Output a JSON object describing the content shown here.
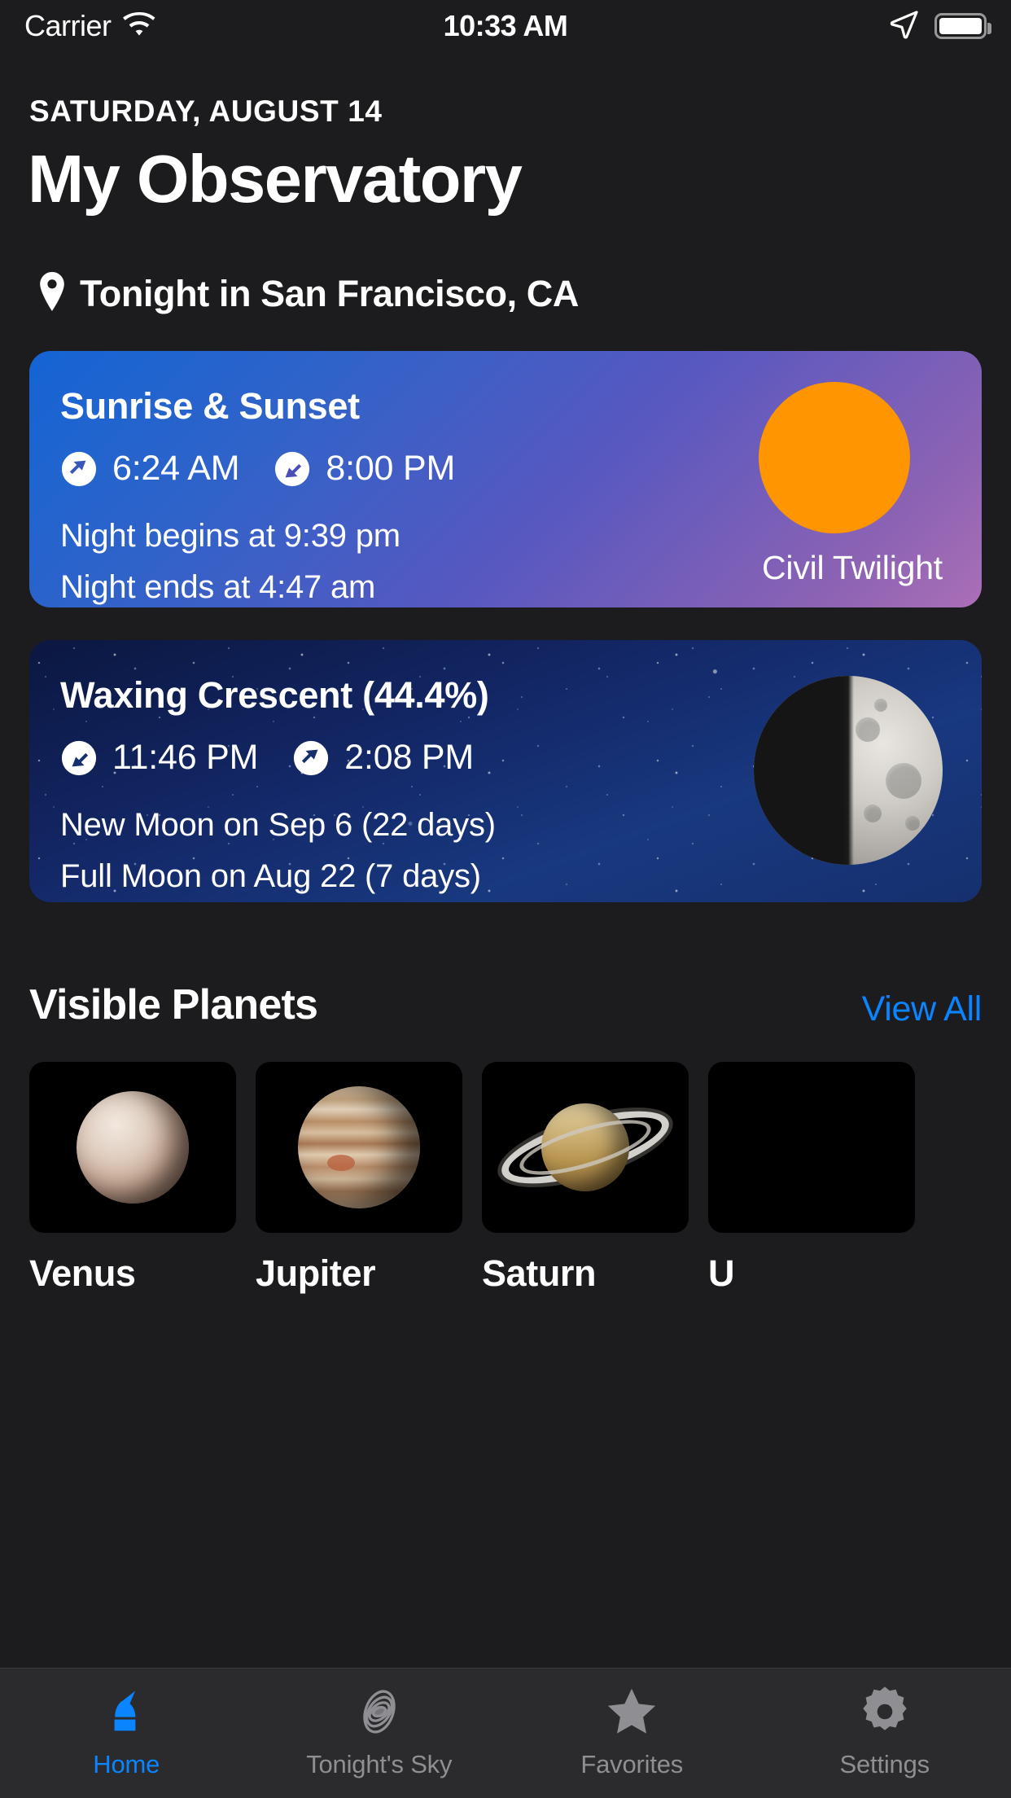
{
  "status_bar": {
    "carrier": "Carrier",
    "time": "10:33 AM",
    "wifi_icon": "wifi-icon",
    "location_icon": "location-arrow-icon",
    "battery_icon": "battery-full-icon"
  },
  "header": {
    "date": "SATURDAY, AUGUST 14",
    "title": "My Observatory",
    "location_icon": "map-pin-icon",
    "location": "Tonight in San Francisco, CA"
  },
  "sun_card": {
    "title": "Sunrise & Sunset",
    "sunrise_icon": "sunrise-arrow-up-icon",
    "sunrise_time": "6:24 AM",
    "sunset_icon": "sunset-arrow-down-icon",
    "sunset_time": "8:00 PM",
    "night_begins": "Night begins at 9:39 pm",
    "night_ends": "Night ends at 4:47 am",
    "twilight_label": "Civil Twilight",
    "sun_color": "#FF9500"
  },
  "moon_card": {
    "title": "Waxing Crescent (44.4%)",
    "moonset_icon": "moonset-arrow-down-icon",
    "moonset_time": "11:46 PM",
    "moonrise_icon": "moonrise-arrow-up-icon",
    "moonrise_time": "2:08 PM",
    "new_moon": "New Moon on Sep 6 (22 days)",
    "full_moon": "Full Moon on Aug 22 (7 days)",
    "illumination_percent": 44.4
  },
  "planets_section": {
    "title": "Visible Planets",
    "view_all": "View All",
    "items": [
      {
        "name": "Venus",
        "image": "venus-thumbnail"
      },
      {
        "name": "Jupiter",
        "image": "jupiter-thumbnail"
      },
      {
        "name": "Saturn",
        "image": "saturn-thumbnail"
      },
      {
        "name": "U",
        "image": "uranus-thumbnail"
      }
    ]
  },
  "tab_bar": {
    "active_color": "#0A84FF",
    "inactive_color": "#8e8e93",
    "items": [
      {
        "label": "Home",
        "icon": "observatory-dome-icon",
        "active": true
      },
      {
        "label": "Tonight's Sky",
        "icon": "galaxy-spiral-icon",
        "active": false
      },
      {
        "label": "Favorites",
        "icon": "star-icon",
        "active": false
      },
      {
        "label": "Settings",
        "icon": "gear-icon",
        "active": false
      }
    ]
  }
}
